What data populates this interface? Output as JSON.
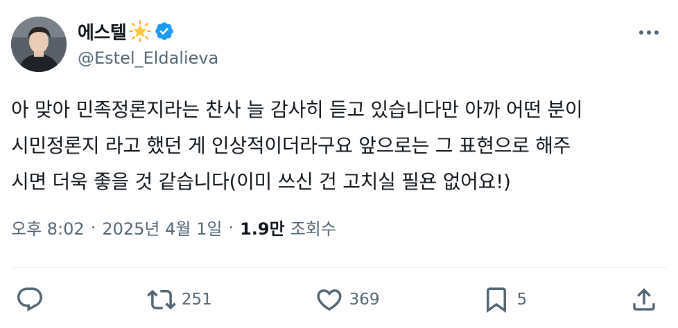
{
  "user": {
    "display_name": "에스텔",
    "handle": "@Estel_Eldalieva",
    "name_emoji_icon": "glowing-star-icon",
    "verified_icon": "verified-badge-icon",
    "verified_color": "#1d9bf0"
  },
  "tweet": {
    "lines": [
      "아 맞아 민족정론지라는 찬사 늘 감사히 듣고 있습니다만 아까 어떤 분이",
      "시민정론지 라고 했던 게 인상적이더라구요 앞으로는 그 표현으로 해주",
      "시면 더욱 좋을 것 같습니다(이미 쓰신 건 고치실 필욘 없어요!)"
    ]
  },
  "meta": {
    "time": "오후 8:02",
    "separator": "·",
    "date": "2025년 4월 1일",
    "views_count": "1.9만",
    "views_label": "조회수"
  },
  "actions": {
    "reply_count": "",
    "retweet_count": "251",
    "like_count": "369",
    "bookmark_count": "5"
  },
  "colors": {
    "text": "#0f1419",
    "secondary": "#536471",
    "divider": "#eff3f4",
    "accent": "#1d9bf0"
  }
}
